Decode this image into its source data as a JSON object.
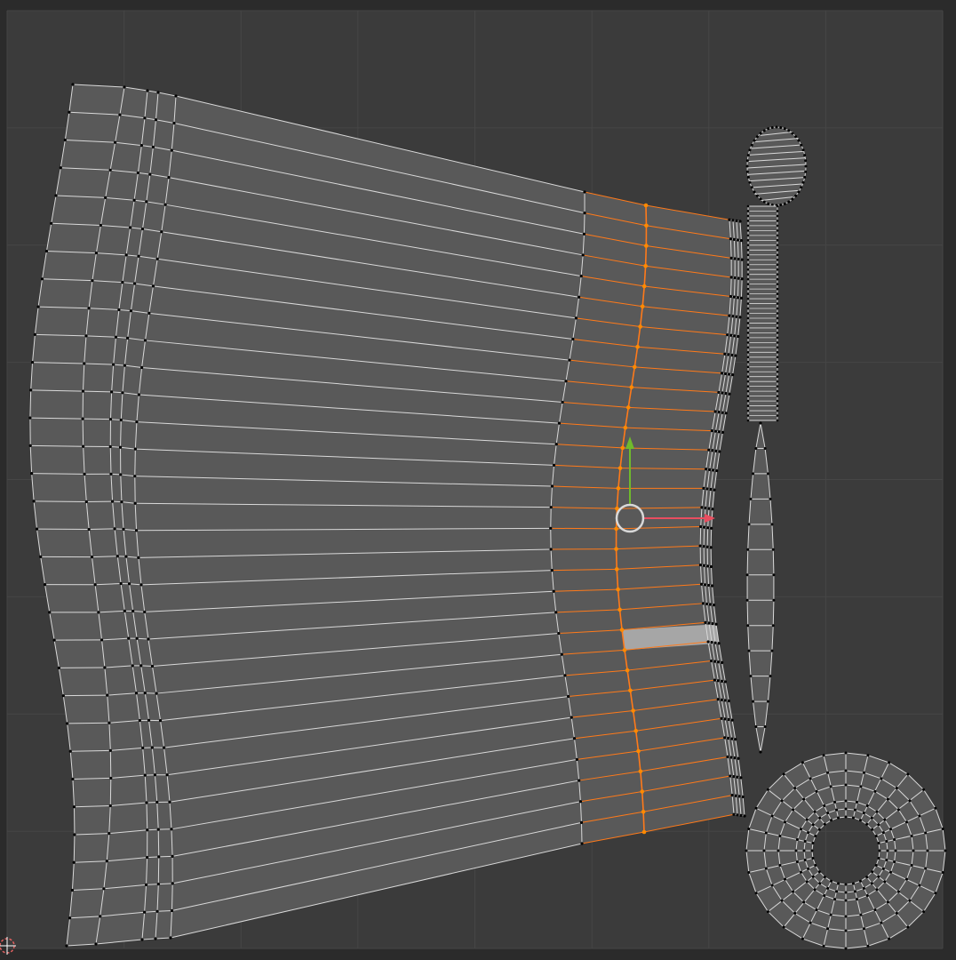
{
  "editor": {
    "type": "uv-editor",
    "background_color": "#2b2b2b",
    "uv_area_color": "#3b3b3b",
    "grid_line_color": "#464646",
    "grid_divisions": 8,
    "face_fill_color": "#595959",
    "edge_color": "#d9d9d9",
    "vertex_color": "#000000",
    "selected_edge_color": "#ff7a1a",
    "selected_vertex_color": "#ff8a00",
    "active_face_color": "#a6a6a6"
  },
  "gizmo": {
    "name": "move-gizmo",
    "x_axis_color": "#e94e60",
    "y_axis_color": "#6fba2c",
    "center_color": "#d8d8d8"
  },
  "cursor": {
    "name": "2d-cursor",
    "color": "#e06060"
  },
  "islands": [
    {
      "name": "body-island",
      "rows": 31,
      "columns": 10
    },
    {
      "name": "cap-oval-island",
      "rows": 12
    },
    {
      "name": "strip-island",
      "rows": 44
    },
    {
      "name": "spindle-island",
      "rows": 13
    },
    {
      "name": "ring-island",
      "segments": 28,
      "rings": 5
    }
  ]
}
